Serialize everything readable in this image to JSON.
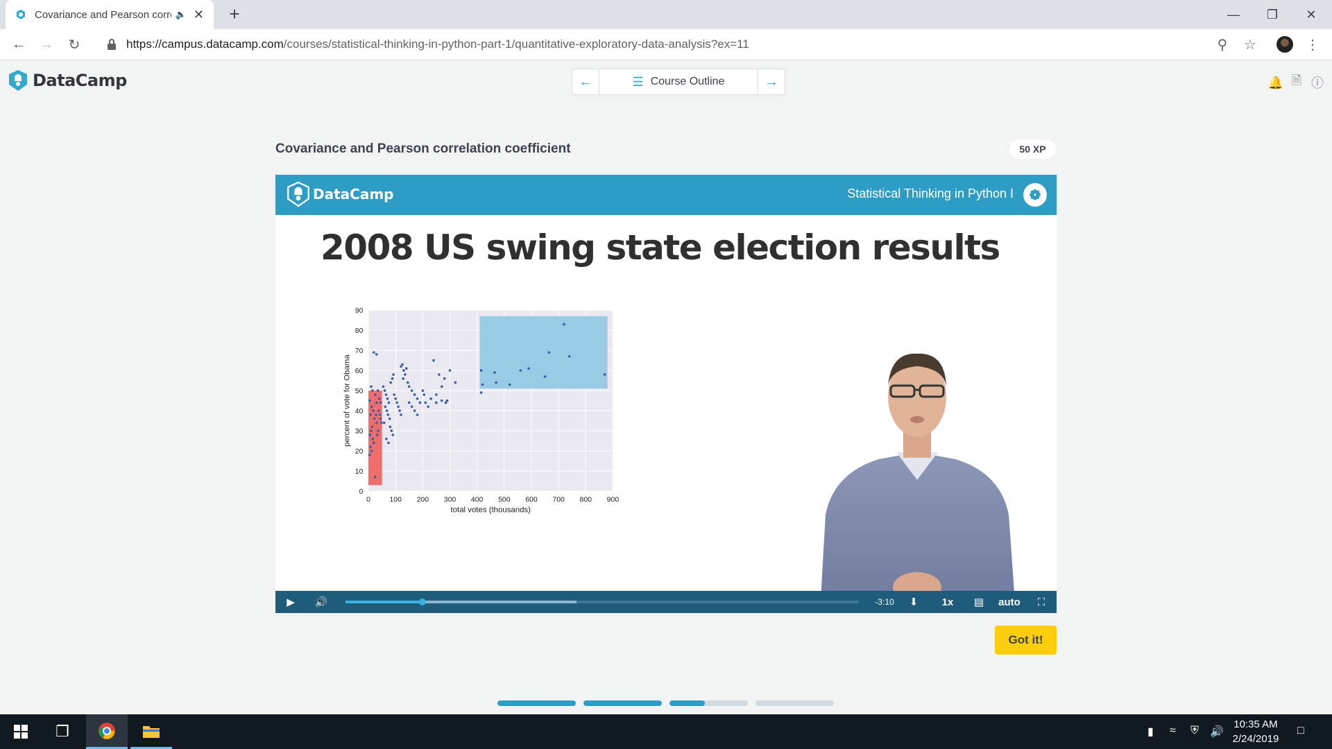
{
  "browser": {
    "tab_title": "Covariance and Pearson correlation coefficient",
    "url_host": "https://campus.datacamp.com",
    "url_path": "/courses/statistical-thinking-in-python-part-1/quantitative-exploratory-data-analysis?ex=11"
  },
  "header": {
    "logo_text": "DataCamp",
    "course_outline": "Course Outline"
  },
  "exercise": {
    "title": "Covariance and Pearson correlation coefficient",
    "xp": "50 XP",
    "got_it": "Got it!"
  },
  "slide": {
    "logo_text": "DataCamp",
    "course_name": "Statistical Thinking in Python I",
    "title": "2008 US swing state election results"
  },
  "player": {
    "time_remaining": "-3:10",
    "speed": "1x",
    "quality": "auto",
    "played_fraction": 0.15,
    "buffered_fraction": 0.45
  },
  "progress_steps": [
    1,
    1,
    0.45,
    0
  ],
  "taskbar": {
    "time": "10:35 AM",
    "date": "2/24/2019"
  },
  "chart_data": {
    "type": "scatter",
    "xlabel": "total votes (thousands)",
    "ylabel": "percent of vote for Obama",
    "xlim": [
      0,
      900
    ],
    "ylim": [
      0,
      90
    ],
    "xticks": [
      0,
      100,
      200,
      300,
      400,
      500,
      600,
      700,
      800,
      900
    ],
    "yticks": [
      0,
      10,
      20,
      30,
      40,
      50,
      60,
      70,
      80,
      90
    ],
    "highlight_regions": [
      {
        "color": "#f0605e",
        "x": [
          0,
          50
        ],
        "y": [
          3,
          50
        ]
      },
      {
        "color": "#8fc8e2",
        "x": [
          410,
          880
        ],
        "y": [
          51,
          87
        ]
      }
    ],
    "points": [
      [
        20,
        69
      ],
      [
        30,
        68
      ],
      [
        10,
        52
      ],
      [
        15,
        50
      ],
      [
        25,
        48
      ],
      [
        5,
        45
      ],
      [
        12,
        42
      ],
      [
        18,
        40
      ],
      [
        8,
        38
      ],
      [
        22,
        36
      ],
      [
        30,
        34
      ],
      [
        14,
        32
      ],
      [
        10,
        30
      ],
      [
        6,
        28
      ],
      [
        16,
        26
      ],
      [
        20,
        24
      ],
      [
        8,
        22
      ],
      [
        12,
        20
      ],
      [
        4,
        18
      ],
      [
        25,
        7
      ],
      [
        35,
        50
      ],
      [
        40,
        46
      ],
      [
        45,
        44
      ],
      [
        30,
        44
      ],
      [
        38,
        40
      ],
      [
        42,
        38
      ],
      [
        28,
        38
      ],
      [
        36,
        30
      ],
      [
        32,
        28
      ],
      [
        44,
        36
      ],
      [
        48,
        34
      ],
      [
        55,
        52
      ],
      [
        60,
        50
      ],
      [
        65,
        48
      ],
      [
        70,
        46
      ],
      [
        75,
        44
      ],
      [
        62,
        42
      ],
      [
        68,
        40
      ],
      [
        72,
        38
      ],
      [
        78,
        36
      ],
      [
        58,
        34
      ],
      [
        80,
        32
      ],
      [
        85,
        30
      ],
      [
        90,
        28
      ],
      [
        66,
        26
      ],
      [
        74,
        24
      ],
      [
        88,
        56
      ],
      [
        92,
        58
      ],
      [
        82,
        54
      ],
      [
        95,
        48
      ],
      [
        100,
        46
      ],
      [
        105,
        44
      ],
      [
        110,
        42
      ],
      [
        115,
        40
      ],
      [
        120,
        38
      ],
      [
        120,
        62
      ],
      [
        125,
        63
      ],
      [
        130,
        60
      ],
      [
        135,
        58
      ],
      [
        140,
        61
      ],
      [
        128,
        56
      ],
      [
        145,
        54
      ],
      [
        150,
        52
      ],
      [
        160,
        50
      ],
      [
        170,
        48
      ],
      [
        180,
        46
      ],
      [
        190,
        44
      ],
      [
        150,
        44
      ],
      [
        160,
        42
      ],
      [
        170,
        40
      ],
      [
        180,
        38
      ],
      [
        200,
        50
      ],
      [
        205,
        48
      ],
      [
        210,
        44
      ],
      [
        220,
        42
      ],
      [
        230,
        46
      ],
      [
        240,
        65
      ],
      [
        250,
        48
      ],
      [
        260,
        58
      ],
      [
        270,
        52
      ],
      [
        280,
        56
      ],
      [
        290,
        45
      ],
      [
        300,
        60
      ],
      [
        320,
        54
      ],
      [
        250,
        44
      ],
      [
        270,
        45
      ],
      [
        285,
        44
      ],
      [
        415,
        60
      ],
      [
        420,
        53
      ],
      [
        415,
        49
      ],
      [
        465,
        59
      ],
      [
        470,
        54
      ],
      [
        520,
        53
      ],
      [
        560,
        60
      ],
      [
        590,
        61
      ],
      [
        650,
        57
      ],
      [
        665,
        69
      ],
      [
        720,
        83
      ],
      [
        740,
        67
      ],
      [
        870,
        58
      ]
    ]
  }
}
